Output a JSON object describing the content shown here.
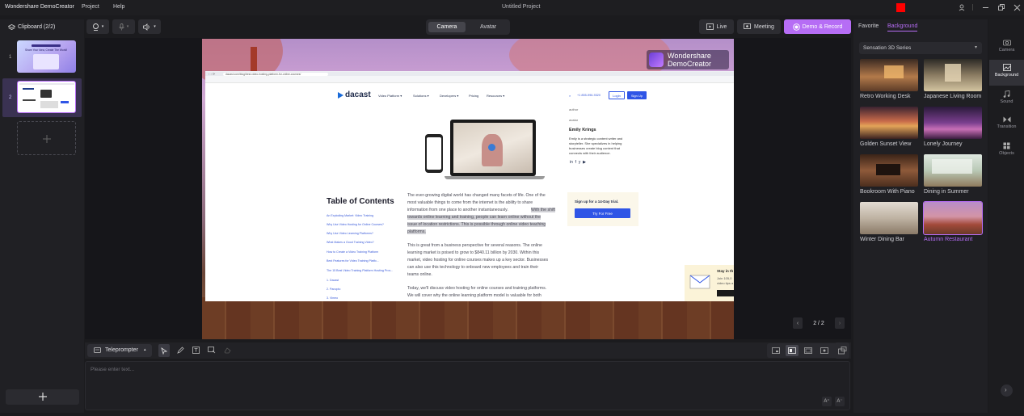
{
  "app": {
    "name": "Wondershare DemoCreator",
    "menu": [
      "Project",
      "Help"
    ],
    "project_title": "Untitled Project"
  },
  "toolbar": {
    "camera_tab": "Camera",
    "avatar_tab": "Avatar",
    "live": "Live",
    "meeting": "Meeting",
    "demo_record": "Demo & Record"
  },
  "left": {
    "clipboard_title": "Clipboard (2/2)",
    "slide_numbers": [
      "1",
      "2"
    ],
    "slide1_caption": "Share Your Idea, Create The World!"
  },
  "right": {
    "tabs": [
      "Favorite",
      "Background"
    ],
    "dropdown": "Sensation 3D Series",
    "backgrounds": [
      {
        "label": "Retro Working Desk"
      },
      {
        "label": "Japanese Living Room"
      },
      {
        "label": "Golden Sunset View"
      },
      {
        "label": "Lonely Journey"
      },
      {
        "label": "Bookroom With Piano"
      },
      {
        "label": "Dining in Summer"
      },
      {
        "label": "Winter Dining Bar"
      },
      {
        "label": "Autumn Restaurant"
      }
    ],
    "selected": "Autumn Restaurant",
    "nav": [
      "Camera",
      "Background",
      "Sound",
      "Transition",
      "Objects"
    ]
  },
  "canvas": {
    "watermark_line1": "Wondershare",
    "watermark_line2": "DemoCreator",
    "page_counter": "2 / 2"
  },
  "webpage": {
    "url": "dacast.com/blog/best-video-hosting-platform-for-online-courses/",
    "logo": "dacast",
    "nav": [
      "Video Platform ▾",
      "Solutions ▾",
      "Developers ▾",
      "Pricing",
      "Resources ▾"
    ],
    "phone": "+1 855-996-9320",
    "login": "Login",
    "signup": "Sign Up",
    "author_alt": "author",
    "author_avatar": "avatar",
    "author_name": "Emily Krings",
    "author_bio": [
      "Emily is a strategic content writer and",
      "storyteller. She specializes in helping",
      "businesses create blog content that",
      "connects with their audience."
    ],
    "toc_title": "Table of Contents",
    "toc_links": [
      "An Exploding Market: Video Training",
      "Why Use Video Hosting for Online Courses?",
      "Why Use Video Learning Platforms?",
      "What Makes a Good Training Video?",
      "How to Create a Video Training Platform",
      "Best Features for Video Training Platfo...",
      "The 15 Best Video Training Platform Hosting Prov...",
      "1. Dacast",
      "2. Panopto",
      "3. Vimeo"
    ],
    "para1": [
      "The ever-growing digital world has changed many facets of life. One of the",
      "most valuable things to come from the internet is the ability to share",
      "information from one place to another instantaneously.",
      "With the shift",
      "towards online learning and training, people can learn online without the",
      "issue of location restrictions. This is possible through online video teaching",
      "platforms."
    ],
    "para2": [
      "This is great from a business perspective for several reasons. The online",
      "learning market is poised to grow to $840.11 billion by 2030. Within this",
      "market, video hosting for online courses makes up a key sector. Businesses",
      "can also use this technology to onboard new employees and train their",
      "teams online."
    ],
    "para3": [
      "Today, we'll discuss video hosting for online courses and training platforms.",
      "We will cover why the online learning platform model is valuable for both"
    ],
    "trial_title": "Sign up for a 14-Day trial.",
    "trial_button": "Try For Free",
    "chat_title": "Stay in th",
    "chat_line1": "Join 105,0",
    "chat_line2": "video tips a"
  },
  "teleprompter": {
    "label": "Teleprompter",
    "placeholder": "Please enter text..."
  },
  "colors": {
    "accent": "#b66df5",
    "bg": "#1b1b1e",
    "red_block": "#ff0000"
  }
}
